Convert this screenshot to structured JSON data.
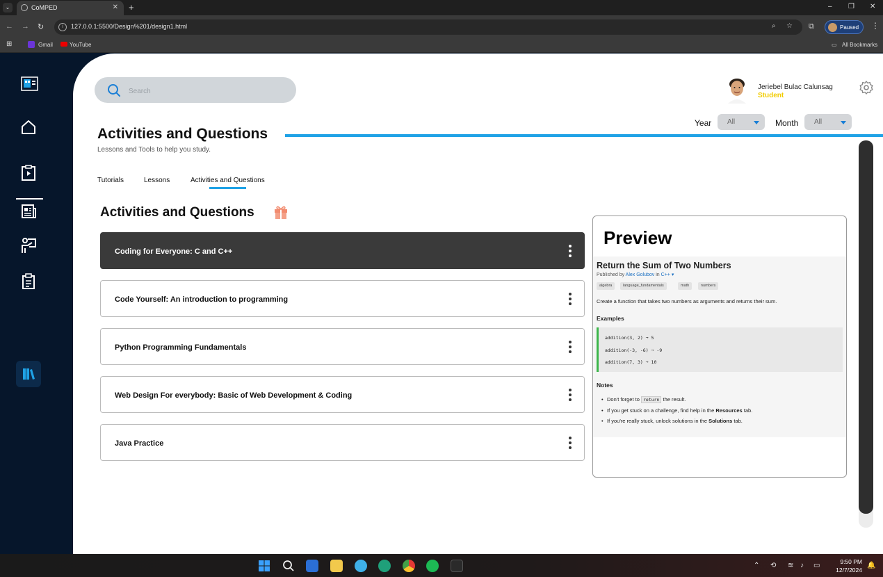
{
  "browser": {
    "tab_title": "CoMPED",
    "new_tab": "+",
    "url": "127.0.0.1:5500/Design%201/design1.html",
    "profile_status": "Paused",
    "window_controls": [
      "–",
      "❐",
      "✕"
    ],
    "bookmarks": [
      {
        "label": "Gmail",
        "icon": "gmail-icon"
      },
      {
        "label": "YouTube",
        "icon": "youtube-icon"
      }
    ],
    "all_bookmarks": "All Bookmarks"
  },
  "sidebar": {
    "items": [
      {
        "name": "logo",
        "icon": "comped-logo-icon"
      },
      {
        "name": "home",
        "icon": "home-icon"
      },
      {
        "name": "tutorials",
        "icon": "clipboard-play-icon"
      },
      {
        "name": "news",
        "icon": "newspaper-icon"
      },
      {
        "name": "teacher",
        "icon": "presentation-icon"
      },
      {
        "name": "tasks",
        "icon": "clipboard-list-icon"
      },
      {
        "name": "library",
        "icon": "books-icon",
        "active": true
      }
    ],
    "accent_color": "#1fa2e6"
  },
  "header": {
    "search_placeholder": "Search",
    "user_name": "Jeriebel Bulac Calunsag",
    "user_role": "Student",
    "filters": {
      "year_label": "Year",
      "year_value": "All",
      "month_label": "Month",
      "month_value": "All"
    }
  },
  "page": {
    "title": "Activities and Questions",
    "subtitle": "Lessons and Tools to help you study.",
    "tabs": [
      "Tutorials",
      "Lessons",
      "Activities and Questions"
    ],
    "active_tab": "Activities and Questions"
  },
  "section": {
    "title": "Activities and Questions",
    "icon": "gift-icon",
    "courses": [
      {
        "title": "Coding for Everyone: C and C++",
        "active": true
      },
      {
        "title": "Code Yourself: An introduction to programming"
      },
      {
        "title": "Python Programming Fundamentals"
      },
      {
        "title": "Web Design For everybody: Basic of Web Development & Coding"
      },
      {
        "title": "Java Practice"
      }
    ]
  },
  "preview": {
    "heading": "Preview",
    "problem_title": "Return the Sum of Two Numbers",
    "published_by": "Published by",
    "author": "Alex Golubov",
    "in": "in",
    "language": "C++ ▾",
    "tags": [
      "algebra",
      "language_fundamentals",
      "math",
      "numbers"
    ],
    "description": "Create a function that takes two numbers as arguments and returns their sum.",
    "examples_heading": "Examples",
    "examples": [
      "addition(3, 2) ➞ 5",
      "addition(-3, -6) ➞ -9",
      "addition(7, 3) ➞ 10"
    ],
    "notes_heading": "Notes",
    "notes": [
      {
        "pre": "Don't forget to ",
        "code": "return",
        "post": " the result."
      },
      {
        "pre": "If you get stuck on a challenge, find help in the ",
        "bold": "Resources",
        "post": " tab."
      },
      {
        "pre": "If you're really stuck, unlock solutions in the ",
        "bold": "Solutions",
        "post": " tab."
      }
    ]
  },
  "taskbar": {
    "time": "9:50 PM",
    "date": "12/7/2024"
  }
}
